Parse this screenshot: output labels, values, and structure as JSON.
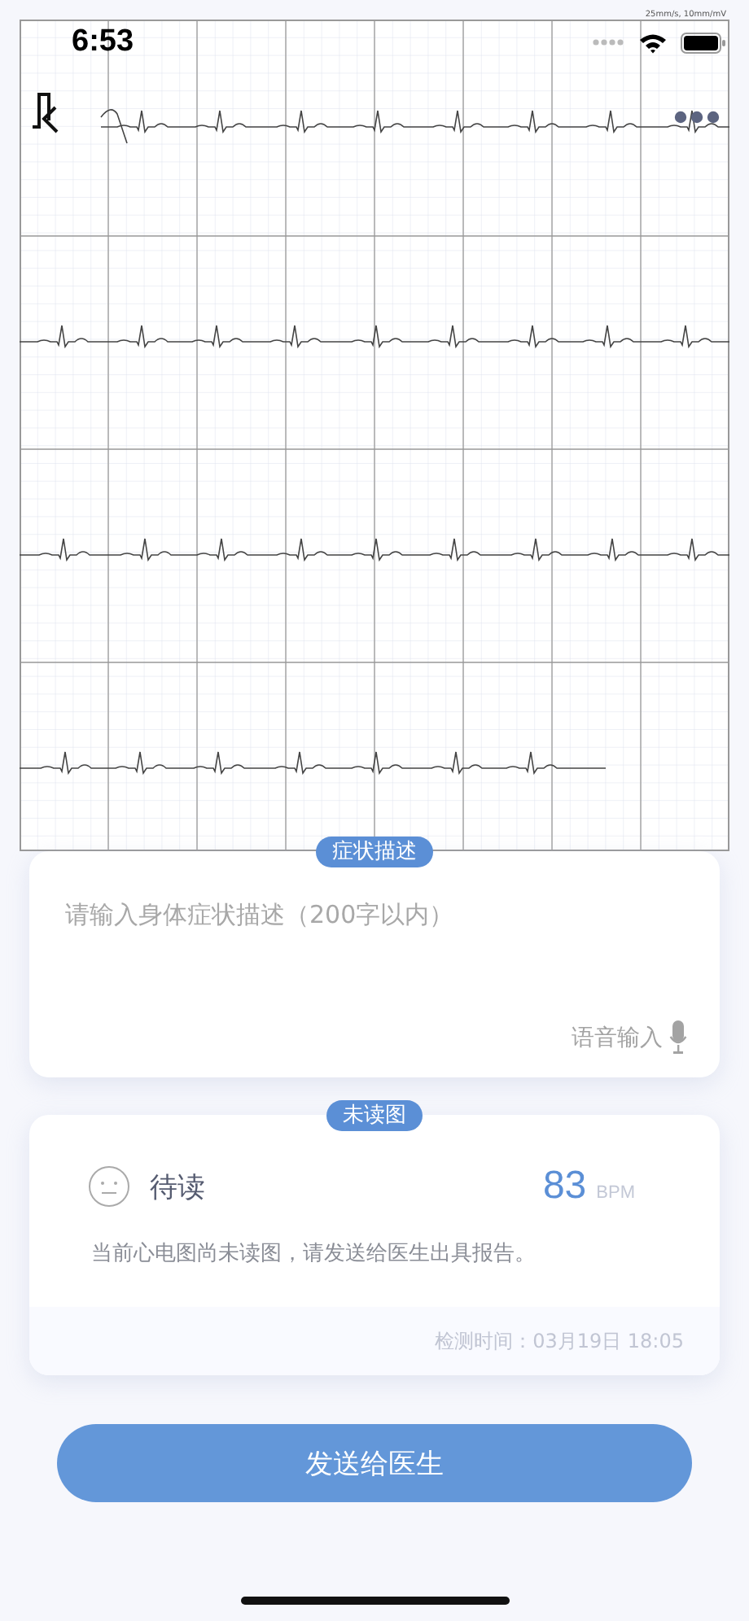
{
  "status_bar": {
    "time": "6:53"
  },
  "ecg": {
    "scale_label": "25mm/s, 10mm/mV"
  },
  "symptom_card": {
    "badge": "症状描述",
    "placeholder": "请输入身体症状描述（200字以内）",
    "voice_input": "语音输入"
  },
  "report_card": {
    "badge": "未读图",
    "status": "待读",
    "heart_rate": "83",
    "unit": "BPM",
    "message": "当前心电图尚未读图，请发送给医生出具报告。",
    "time_label": "检测时间：03月19日 18:05"
  },
  "send_button": "发送给医生"
}
